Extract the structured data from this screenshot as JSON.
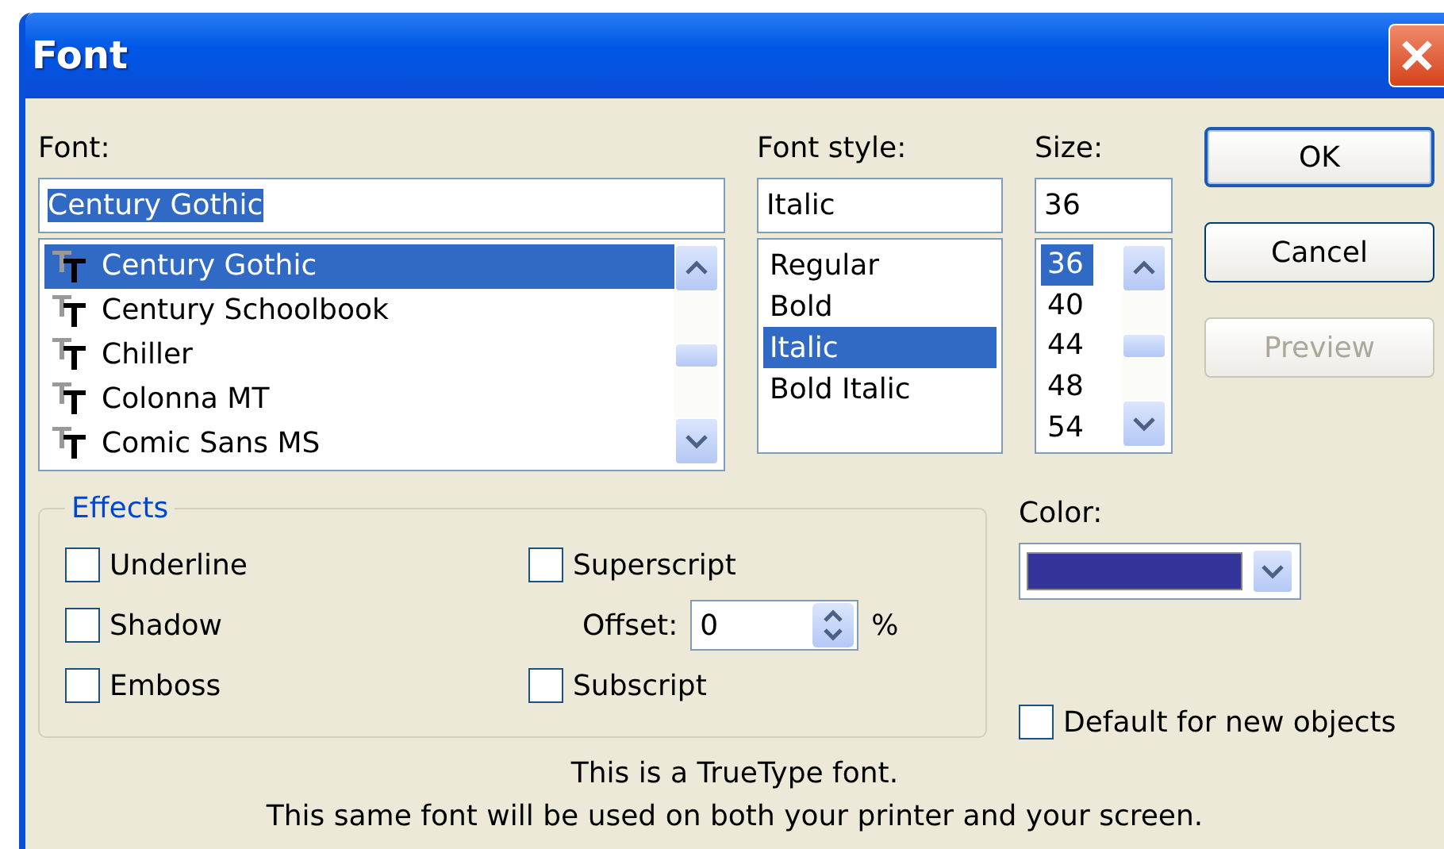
{
  "window": {
    "title": "Font"
  },
  "font": {
    "label": "Font:",
    "value": "Century Gothic",
    "value_selected": true,
    "items": [
      {
        "label": "Century Gothic",
        "selected": true
      },
      {
        "label": "Century Schoolbook",
        "selected": false
      },
      {
        "label": "Chiller",
        "selected": false
      },
      {
        "label": "Colonna MT",
        "selected": false
      },
      {
        "label": "Comic Sans MS",
        "selected": false
      }
    ]
  },
  "font_style": {
    "label": "Font style:",
    "value": "Italic",
    "items": [
      {
        "label": "Regular",
        "selected": false
      },
      {
        "label": "Bold",
        "selected": false
      },
      {
        "label": "Italic",
        "selected": true
      },
      {
        "label": "Bold Italic",
        "selected": false
      }
    ]
  },
  "size": {
    "label": "Size:",
    "value": "36",
    "items": [
      {
        "label": "36",
        "selected": true
      },
      {
        "label": "40",
        "selected": false
      },
      {
        "label": "44",
        "selected": false
      },
      {
        "label": "48",
        "selected": false
      },
      {
        "label": "54",
        "selected": false
      }
    ]
  },
  "buttons": [
    {
      "label": "OK",
      "disabled": false,
      "default": true
    },
    {
      "label": "Cancel",
      "disabled": false,
      "default": false
    },
    {
      "label": "Preview",
      "disabled": true,
      "default": false
    }
  ],
  "effects": {
    "title": "Effects",
    "items": [
      {
        "kind": "checkbox",
        "label": "Underline",
        "checked": false
      },
      {
        "kind": "checkbox",
        "label": "Superscript",
        "checked": false
      },
      {
        "kind": "checkbox",
        "label": "Shadow",
        "checked": false
      },
      {
        "kind": "spinner",
        "label": "Offset:",
        "value": "0",
        "unit": "%"
      },
      {
        "kind": "checkbox",
        "label": "Emboss",
        "checked": false
      },
      {
        "kind": "checkbox",
        "label": "Subscript",
        "checked": false
      }
    ]
  },
  "color": {
    "label": "Color:",
    "color": "#333399"
  },
  "default_for_new": {
    "label": "Default for new objects",
    "checked": false
  },
  "description": [
    "This is a TrueType font.",
    "This same font will be used on both your printer and your screen."
  ]
}
